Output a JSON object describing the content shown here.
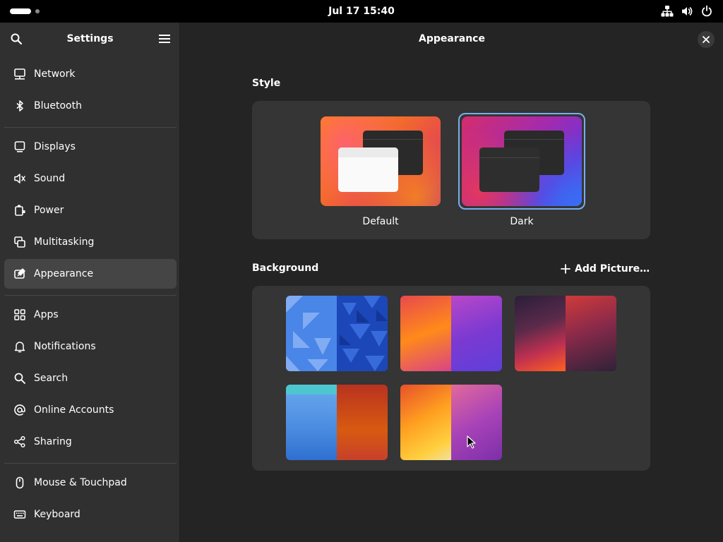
{
  "topbar": {
    "clock": "Jul 17  15:40",
    "icons": [
      "network-wired-icon",
      "volume-icon",
      "power-icon"
    ]
  },
  "sidebar": {
    "title": "Settings",
    "items": [
      {
        "label": "Network",
        "icon": "network-icon"
      },
      {
        "label": "Bluetooth",
        "icon": "bluetooth-icon"
      },
      {
        "label": "Displays",
        "icon": "display-icon"
      },
      {
        "label": "Sound",
        "icon": "speaker-icon"
      },
      {
        "label": "Power",
        "icon": "battery-icon"
      },
      {
        "label": "Multitasking",
        "icon": "multitasking-icon"
      },
      {
        "label": "Appearance",
        "icon": "appearance-icon",
        "active": true
      },
      {
        "label": "Apps",
        "icon": "apps-grid-icon"
      },
      {
        "label": "Notifications",
        "icon": "bell-icon"
      },
      {
        "label": "Search",
        "icon": "search-icon"
      },
      {
        "label": "Online Accounts",
        "icon": "at-sign-icon"
      },
      {
        "label": "Sharing",
        "icon": "share-icon"
      },
      {
        "label": "Mouse & Touchpad",
        "icon": "mouse-icon"
      },
      {
        "label": "Keyboard",
        "icon": "keyboard-icon"
      }
    ]
  },
  "main": {
    "title": "Appearance",
    "style": {
      "heading": "Style",
      "options": [
        {
          "label": "Default",
          "selected": false
        },
        {
          "label": "Dark",
          "selected": true
        }
      ]
    },
    "background": {
      "heading": "Background",
      "add_label": "Add Picture…",
      "wallpapers": [
        {
          "name": "blue-triangles"
        },
        {
          "name": "orange-magenta-waves"
        },
        {
          "name": "dark-red-contours"
        },
        {
          "name": "blue-orange-drips"
        },
        {
          "name": "yellow-purple-fold"
        }
      ]
    }
  },
  "colors": {
    "accent": "#78aeed",
    "sidebar_bg": "#303030",
    "main_bg": "#242424",
    "card_bg": "#353535"
  }
}
